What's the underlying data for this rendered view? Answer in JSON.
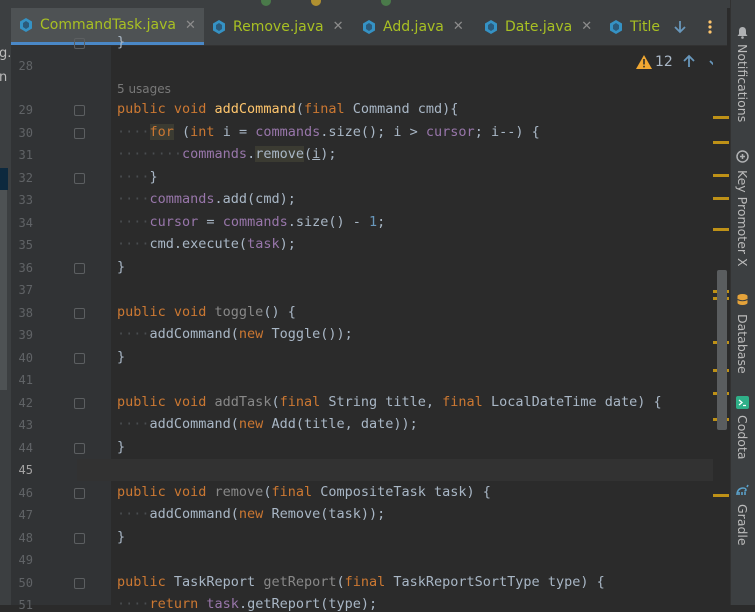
{
  "left_panel": {
    "fragments": [
      "g.",
      "n"
    ]
  },
  "tabs": [
    {
      "label": "CommandTask.java",
      "active": true
    },
    {
      "label": "Remove.java",
      "active": false
    },
    {
      "label": "Add.java",
      "active": false
    },
    {
      "label": "Date.java",
      "active": false
    },
    {
      "label": "Title",
      "active": false
    }
  ],
  "tab_tools": {
    "recent_icon": "arrow-down",
    "more_icon": "kebab-menu"
  },
  "inspections": {
    "warning_count": "12"
  },
  "usages_hint": "5 usages",
  "line_numbers": [
    "28",
    "29",
    "30",
    "31",
    "32",
    "33",
    "34",
    "35",
    "36",
    "37",
    "38",
    "39",
    "40",
    "41",
    "42",
    "43",
    "44",
    "45",
    "46",
    "47",
    "48",
    "49",
    "50",
    "51"
  ],
  "current_line": "45",
  "right_sidebar": {
    "notifications": "Notifications",
    "key_promoter": "Key Promoter X",
    "database": "Database",
    "codota": "Codota",
    "gradle": "Gradle"
  },
  "colors": {
    "keyword": "#cc7832",
    "method": "#ffc66d",
    "field": "#9876aa",
    "number": "#6897bb",
    "text": "#a9b7c6",
    "background": "#2b2b2b",
    "tab_file_name": "#a8c023"
  }
}
